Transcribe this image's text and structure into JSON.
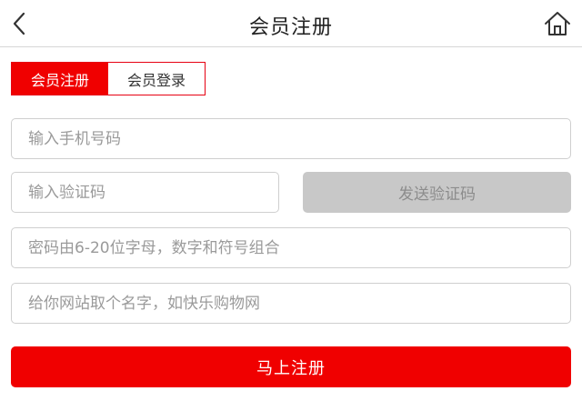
{
  "header": {
    "title": "会员注册",
    "back_icon": "chevron-left-icon",
    "home_icon": "home-icon"
  },
  "tabs": [
    {
      "label": "会员注册",
      "active": true
    },
    {
      "label": "会员登录",
      "active": false
    }
  ],
  "form": {
    "phone": {
      "placeholder": "输入手机号码",
      "value": ""
    },
    "code": {
      "placeholder": "输入验证码",
      "value": ""
    },
    "send_code_label": "发送验证码",
    "password": {
      "placeholder": "密码由6-20位字母，数字和符号组合",
      "value": ""
    },
    "site_name": {
      "placeholder": "给你网站取个名字，如快乐购物网",
      "value": ""
    },
    "submit_label": "马上注册"
  },
  "colors": {
    "accent": "#f00000",
    "disabled_button": "#c8c8c8",
    "border": "#cfcfcf"
  }
}
